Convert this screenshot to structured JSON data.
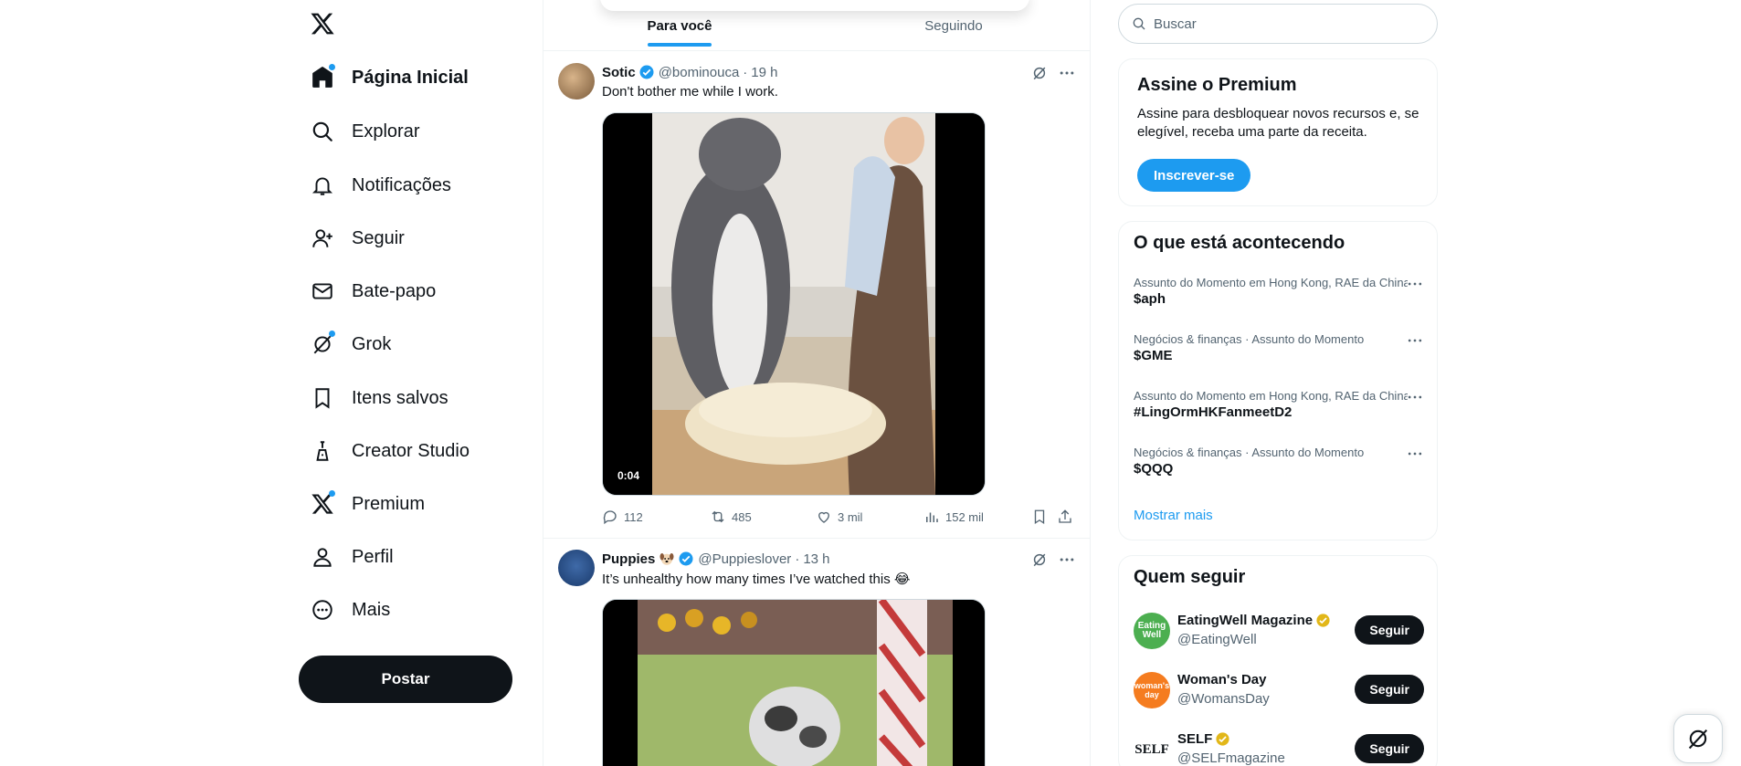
{
  "sidebar": {
    "logo": "x-logo",
    "items": [
      {
        "label": "Página Inicial",
        "icon": "home-icon"
      },
      {
        "label": "Explorar",
        "icon": "search-icon"
      },
      {
        "label": "Notificações",
        "icon": "bell-icon"
      },
      {
        "label": "Seguir",
        "icon": "person-plus-icon"
      },
      {
        "label": "Bate-papo",
        "icon": "envelope-icon"
      },
      {
        "label": "Grok",
        "icon": "grok-icon"
      },
      {
        "label": "Itens salvos",
        "icon": "bookmark-icon"
      },
      {
        "label": "Creator Studio",
        "icon": "flask-icon"
      },
      {
        "label": "Premium",
        "icon": "x-icon"
      },
      {
        "label": "Perfil",
        "icon": "person-icon"
      },
      {
        "label": "Mais",
        "icon": "more-circle-icon"
      }
    ],
    "post_label": "Postar"
  },
  "feed": {
    "tabs": [
      {
        "label": "Para você",
        "active": true
      },
      {
        "label": "Seguindo",
        "active": false
      }
    ],
    "tweets": [
      {
        "name": "Sotic",
        "handle": "@bominouca",
        "sep": "·",
        "time": "19 h",
        "text": "Don't bother me while I work.",
        "duration": "0:04",
        "replies": "112",
        "retweets": "485",
        "likes": "3 mil",
        "views": "152 mil"
      },
      {
        "name": "Puppies",
        "handle": "@Puppieslover",
        "sep": "·",
        "time": "13 h",
        "text": "It’s unhealthy how many times I’ve watched this 😂"
      }
    ]
  },
  "right": {
    "search_placeholder": "Buscar",
    "premium": {
      "title": "Assine o Premium",
      "desc": "Assine para desbloquear novos recursos e, se elegível, receba uma parte da receita.",
      "button": "Inscrever-se"
    },
    "trends": {
      "title": "O que está acontecendo",
      "items": [
        {
          "meta": "Assunto do Momento em Hong Kong, RAE da China",
          "name": "$aph"
        },
        {
          "meta": "Negócios & finanças · Assunto do Momento",
          "name": "$GME"
        },
        {
          "meta": "Assunto do Momento em Hong Kong, RAE da China",
          "name": "#LingOrmHKFanmeetD2"
        },
        {
          "meta": "Negócios & finanças · Assunto do Momento",
          "name": "$QQQ"
        }
      ],
      "show_more": "Mostrar mais"
    },
    "who_to_follow": {
      "title": "Quem seguir",
      "items": [
        {
          "name": "EatingWell Magazine",
          "handle": "@EatingWell",
          "avatar_text": "Eating Well",
          "avatar_color": "#4caf50",
          "button": "Seguir"
        },
        {
          "name": "Woman's Day",
          "handle": "@WomansDay",
          "avatar_text": "woman's day",
          "avatar_color": "#f57c1f",
          "button": "Seguir"
        },
        {
          "name": "SELF",
          "handle": "@SELFmagazine",
          "avatar_text": "SELF",
          "avatar_color": "#ffffff",
          "button": "Seguir"
        }
      ]
    }
  },
  "colors": {
    "accent": "#1d9bf0",
    "text": "#0f1419",
    "muted": "#536471",
    "gold_badge": "#e2b719"
  }
}
